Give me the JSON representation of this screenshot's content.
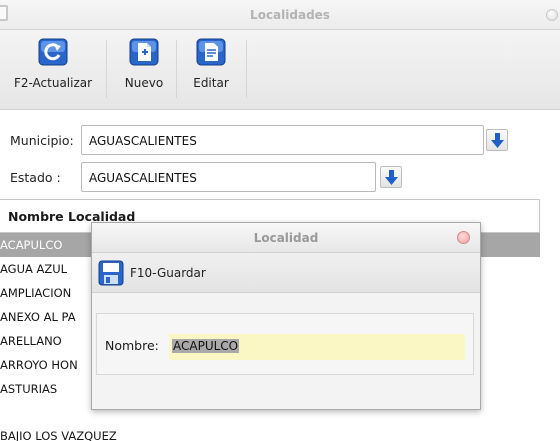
{
  "window": {
    "title": "Localidades"
  },
  "toolbar": {
    "refresh_label": "F2-Actualizar",
    "new_label": "Nuevo",
    "edit_label": "Editar"
  },
  "form": {
    "municipio_label": "Municipio:",
    "municipio_value": "AGUASCALIENTES",
    "estado_label": "Estado :",
    "estado_value": "AGUASCALIENTES"
  },
  "list": {
    "header": "Nombre Localidad",
    "rows": [
      "ACAPULCO",
      "AGUA AZUL",
      "AMPLIACION",
      "ANEXO AL PA",
      "ARELLANO",
      "ARROYO HON",
      "ASTURIAS",
      "BAJIO LOS VAZQUEZ"
    ],
    "selected_index": 0
  },
  "dialog": {
    "title": "Localidad",
    "save_label": "F10-Guardar",
    "name_label": "Nombre:",
    "name_value": "ACAPULCO"
  },
  "colors": {
    "accent_blue": "#1f5fc8",
    "selection_gray": "#a6a6a6",
    "input_highlight": "#fbf7c4",
    "dialog_close": "#f2a2a2"
  },
  "icons": {
    "refresh": "refresh-icon",
    "new": "new-document-icon",
    "edit": "edit-document-icon",
    "dropdown": "arrow-down-icon",
    "save": "save-disk-icon"
  }
}
